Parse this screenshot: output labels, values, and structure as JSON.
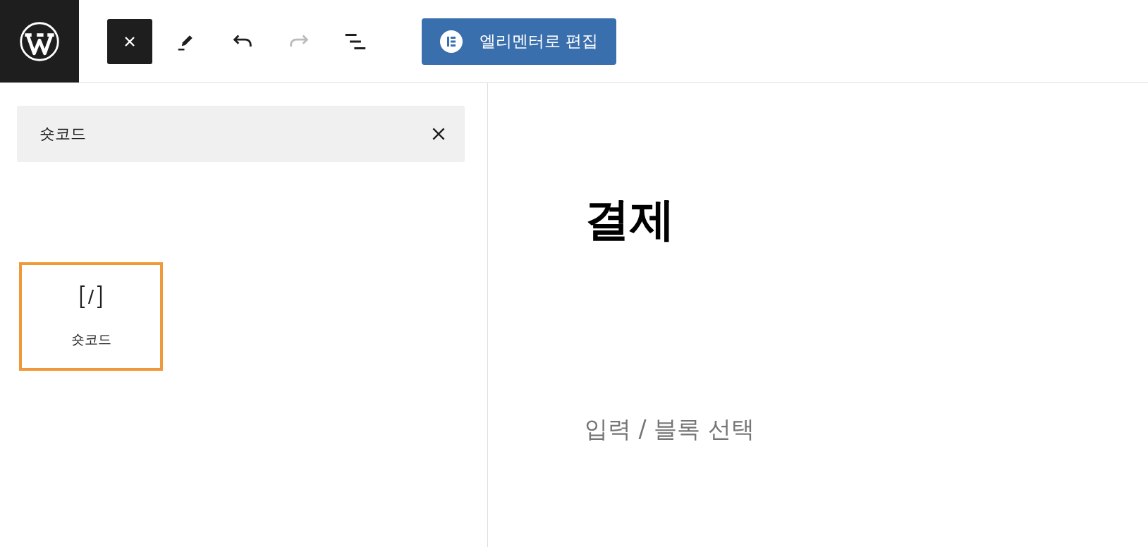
{
  "toolbar": {
    "tools": [
      {
        "kind": "close",
        "pressed": true,
        "disabled": false
      },
      {
        "kind": "pencil",
        "pressed": false,
        "disabled": false
      },
      {
        "kind": "undo",
        "pressed": false,
        "disabled": false
      },
      {
        "kind": "redo",
        "pressed": false,
        "disabled": true
      },
      {
        "kind": "outline",
        "pressed": false,
        "disabled": false
      }
    ],
    "elementor_button": {
      "label": "엘리멘터로 편집"
    }
  },
  "inserter": {
    "search": {
      "value": "숏코드"
    },
    "blocks": [
      {
        "label": "숏코드",
        "selected": true
      }
    ]
  },
  "editor": {
    "title": "결제",
    "placeholder": "입력 / 블록 선택"
  }
}
